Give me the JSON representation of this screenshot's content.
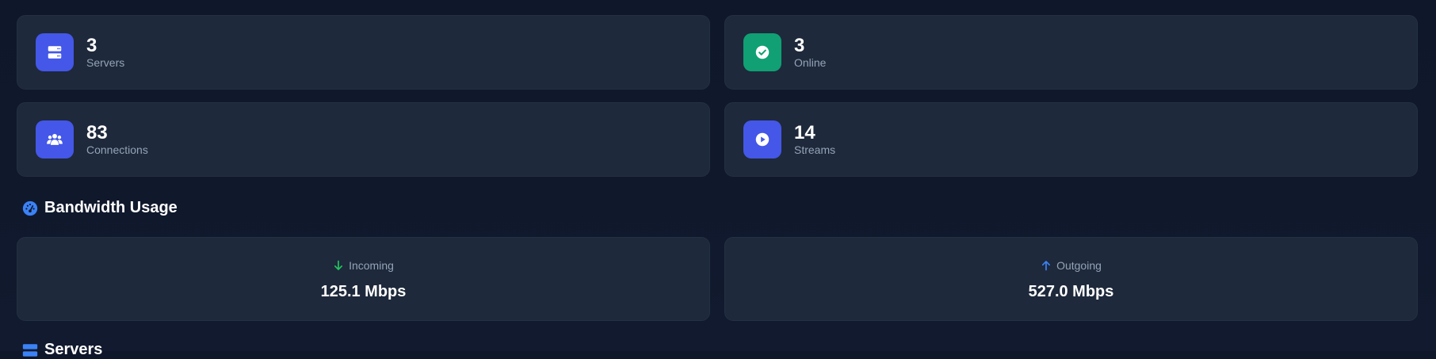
{
  "stats": [
    {
      "value": "3",
      "label": "Servers",
      "icon": "server-icon",
      "color": "#4457e8"
    },
    {
      "value": "3",
      "label": "Online",
      "icon": "check-circle-icon",
      "color": "#10a074"
    },
    {
      "value": "83",
      "label": "Connections",
      "icon": "users-icon",
      "color": "#4457e8"
    },
    {
      "value": "14",
      "label": "Streams",
      "icon": "play-circle-icon",
      "color": "#4457e8"
    }
  ],
  "bandwidth": {
    "title": "Bandwidth Usage",
    "incoming": {
      "label": "Incoming",
      "value": "125.1 Mbps",
      "color": "#22c55e"
    },
    "outgoing": {
      "label": "Outgoing",
      "value": "527.0 Mbps",
      "color": "#3b82f6"
    }
  },
  "servers_section": {
    "title": "Servers"
  },
  "colors": {
    "background": "#0f172a",
    "card": "#1e293b",
    "accent": "#3b82f6",
    "muted_text": "#94a3b8"
  }
}
